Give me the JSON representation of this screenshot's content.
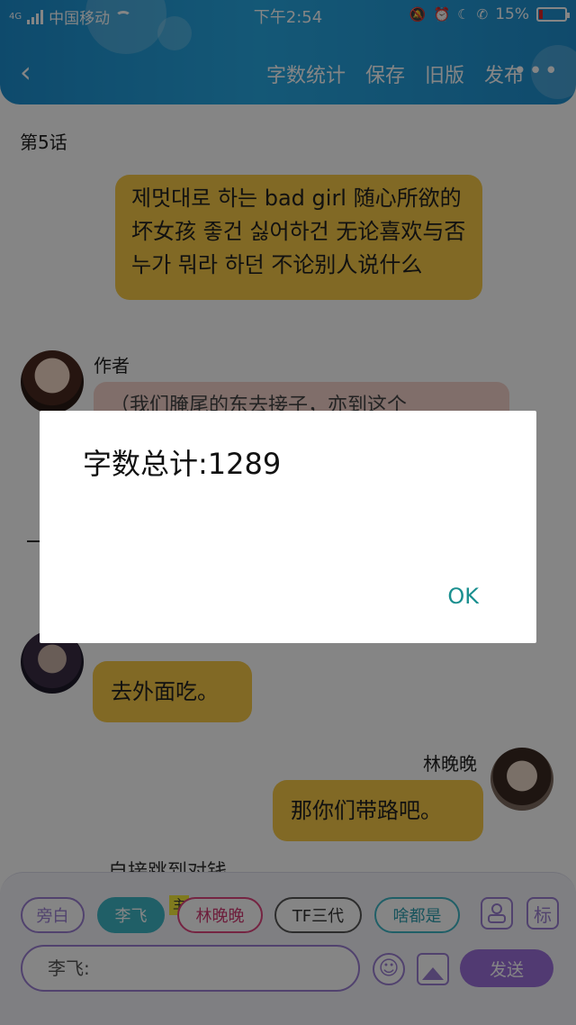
{
  "statusbar": {
    "network": "4G",
    "carrier": "中国移动",
    "time": "下午2:54",
    "battery": "15%",
    "battery_level": 0.15
  },
  "header": {
    "menu": [
      "字数统计",
      "保存",
      "旧版",
      "发布"
    ],
    "more": "•••"
  },
  "chat": {
    "chapter": "第5话",
    "narration": "제멋대로 하는 bad girl  随心所欲的坏女孩  좋건 싫어하건  无论喜欢与否  누가 뭐라 하던  不论别人说什么",
    "author_label": "作者",
    "author_text": "（我们腌尾的东去接子，亦到这个",
    "msg1": "去外面吃。",
    "msg2_name": "林晚晚",
    "msg2": "那你们带路吧。",
    "partial": "自接跳到对钱"
  },
  "bottom": {
    "roles": [
      "旁白",
      "李飞",
      "林晚晚",
      "TF三代",
      "啥都是"
    ],
    "main_tag": "主",
    "person_btn": "person-icon",
    "tag_btn": "标",
    "input_prefix": "李飞:",
    "send": "发送"
  },
  "dialog": {
    "message": "字数总计:1289",
    "ok": "OK"
  },
  "colors": {
    "header": "#28a9e3",
    "bubble": "#f7c948",
    "accent": "#9b6fdb",
    "ok": "#1a8f8f"
  }
}
